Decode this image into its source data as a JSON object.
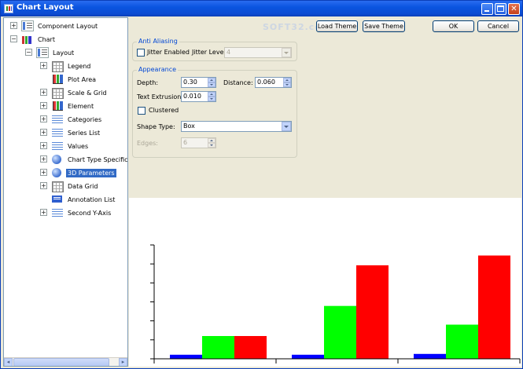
{
  "window": {
    "title": "Chart Layout",
    "watermark": "SOFT32.com"
  },
  "titlebar_buttons": {
    "minimize_icon": "minimize-icon",
    "maximize_icon": "maximize-icon",
    "close_icon": "close-icon",
    "close_glyph": "✕"
  },
  "toolbar": {
    "load_theme": "Load Theme",
    "save_theme": "Save Theme",
    "ok": "OK",
    "cancel": "Cancel"
  },
  "tree": {
    "component_layout": "Component Layout",
    "chart": "Chart",
    "layout": "Layout",
    "items": [
      {
        "label": "Legend",
        "icon": "legend-icon"
      },
      {
        "label": "Plot Area",
        "icon": "plot-area-icon"
      },
      {
        "label": "Scale & Grid",
        "icon": "scale-grid-icon"
      },
      {
        "label": "Element",
        "icon": "element-icon"
      },
      {
        "label": "Categories",
        "icon": "categories-icon"
      },
      {
        "label": "Series List",
        "icon": "series-list-icon"
      },
      {
        "label": "Values",
        "icon": "values-icon"
      },
      {
        "label": "Chart Type Specific Se",
        "icon": "chart-type-icon"
      },
      {
        "label": "3D Parameters",
        "icon": "3d-parameters-icon",
        "selected": true
      },
      {
        "label": "Data Grid",
        "icon": "data-grid-icon"
      },
      {
        "label": "Annotation List",
        "icon": "annotation-list-icon"
      },
      {
        "label": "Second Y-Axis",
        "icon": "second-y-axis-icon"
      }
    ],
    "expander_open": "−",
    "expander_closed": "+"
  },
  "anti_aliasing": {
    "title": "Anti Aliasing",
    "jitter_enabled_label": "Jitter Enabled",
    "jitter_enabled_checked": false,
    "jitter_level_label": "Jitter Level",
    "jitter_level_value": "4"
  },
  "appearance": {
    "title": "Appearance",
    "depth_label": "Depth:",
    "depth_value": "0.30",
    "distance_label": "Distance:",
    "distance_value": "0.060",
    "text_extrusion_label": "Text Extrusion:",
    "text_extrusion_value": "0.010",
    "clustered_label": "Clustered",
    "clustered_checked": false,
    "shape_type_label": "Shape Type:",
    "shape_type_value": "Box",
    "edges_label": "Edges:",
    "edges_value": "6"
  },
  "chart_data": {
    "type": "bar",
    "categories": [
      "",
      "",
      ""
    ],
    "series": [
      {
        "values": [
          5,
          5,
          6
        ],
        "color": "#0000ff"
      },
      {
        "values": [
          28,
          65,
          42
        ],
        "color": "#00ff00"
      },
      {
        "values": [
          28,
          115,
          127
        ],
        "color": "#ff0000"
      }
    ],
    "ylim": [
      0,
      140
    ],
    "ytick_count": 6,
    "title": "",
    "xlabel": "",
    "ylabel": ""
  }
}
